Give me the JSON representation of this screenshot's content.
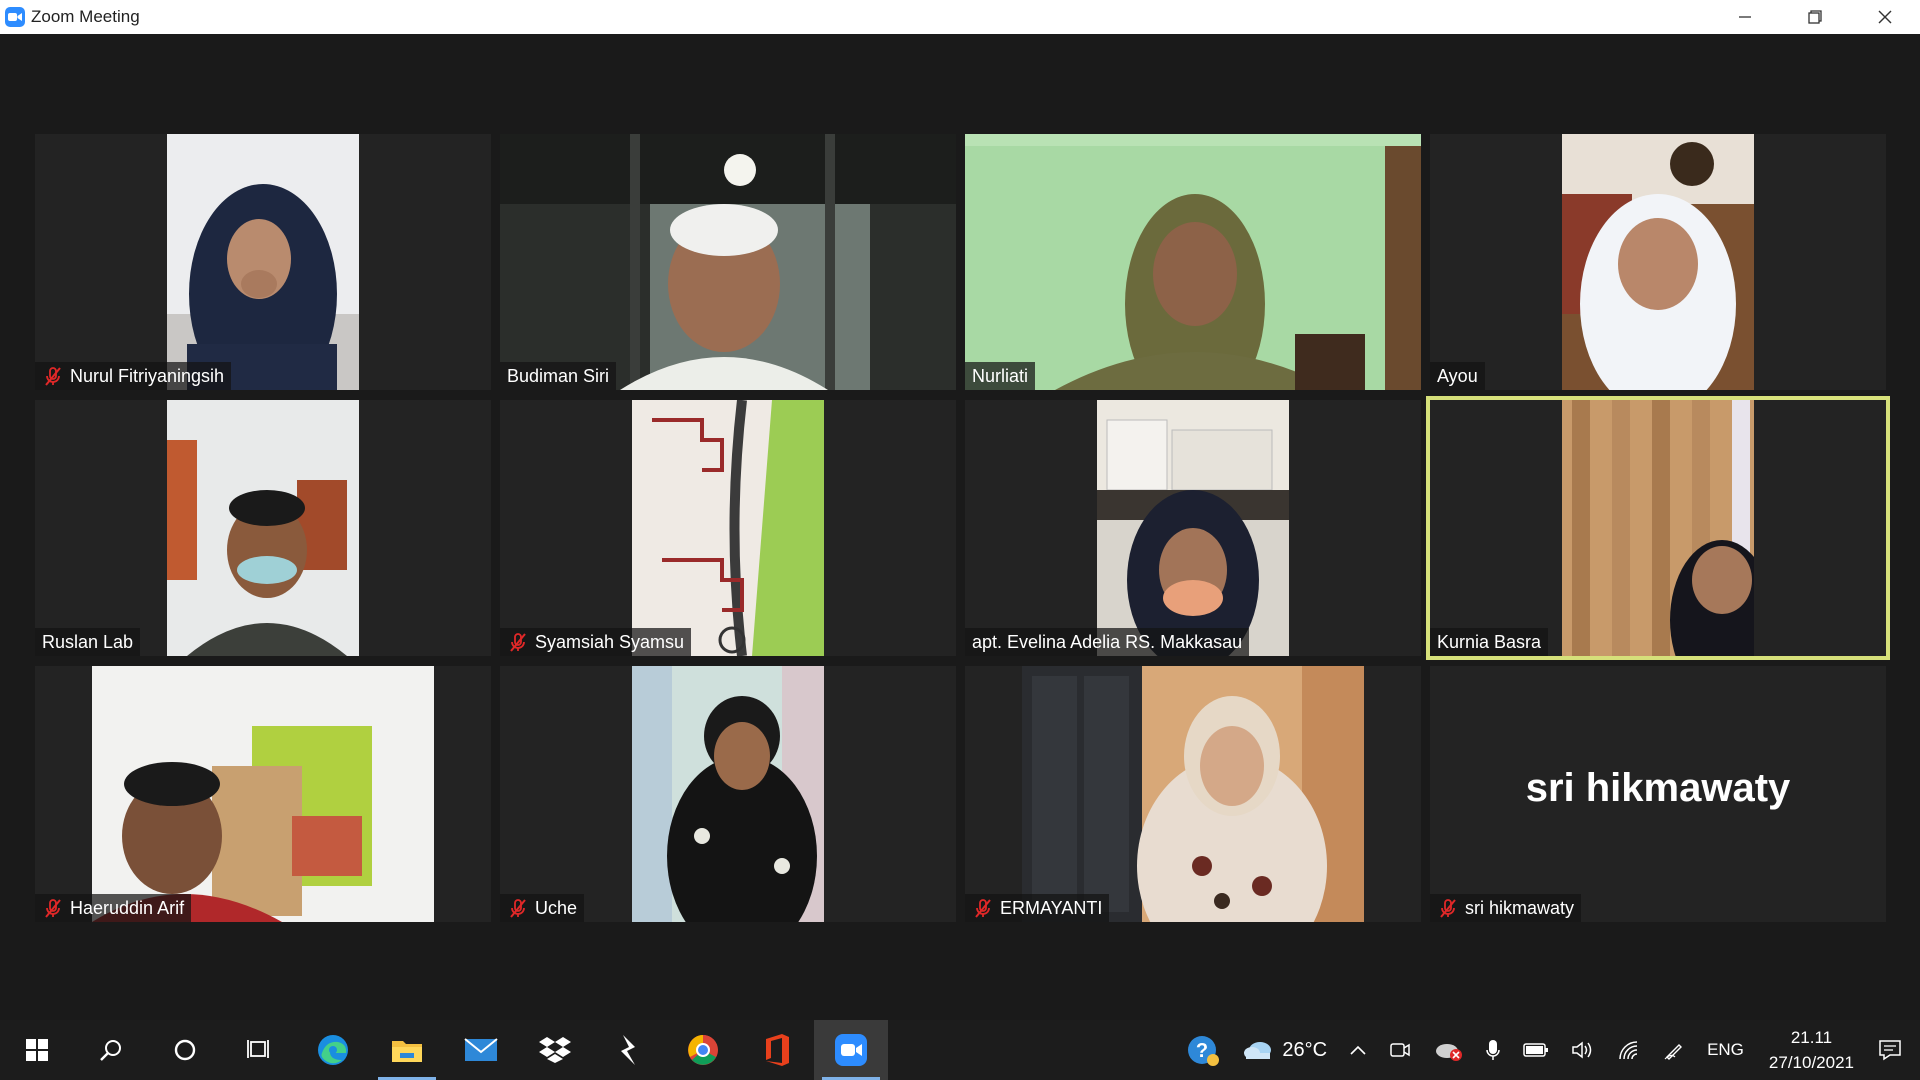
{
  "window": {
    "title": "Zoom Meeting"
  },
  "participants": [
    {
      "name": "Nurul Fitriyaningsih",
      "muted": true
    },
    {
      "name": "Budiman Siri",
      "muted": false
    },
    {
      "name": "Nurliati",
      "muted": false
    },
    {
      "name": "Ayou",
      "muted": false
    },
    {
      "name": "Ruslan Lab",
      "muted": false
    },
    {
      "name": "Syamsiah Syamsu",
      "muted": true
    },
    {
      "name": "apt. Evelina Adelia RS. Makkasau",
      "muted": false
    },
    {
      "name": "Kurnia Basra",
      "muted": false,
      "active_speaker": true
    },
    {
      "name": "Haeruddin Arif",
      "muted": true
    },
    {
      "name": "Uche",
      "muted": true
    },
    {
      "name": "ERMAYANTI",
      "muted": true
    },
    {
      "name": "sri hikmawaty",
      "muted": true,
      "video_off": true,
      "display_name_large": "sri hikmawaty"
    }
  ],
  "colors": {
    "active_speaker_border": "#d6e07a",
    "zoom_blue": "#2D8CFF",
    "mute_red": "#e02828"
  },
  "taskbar": {
    "apps": [
      "windows-start",
      "search",
      "cortana",
      "task-view",
      "edge",
      "file-explorer",
      "mail",
      "dropbox",
      "bolt-app",
      "chrome",
      "office",
      "zoom"
    ],
    "weather": {
      "temp": "26°C"
    },
    "language": "ENG",
    "time": "21.11",
    "date": "27/10/2021"
  }
}
